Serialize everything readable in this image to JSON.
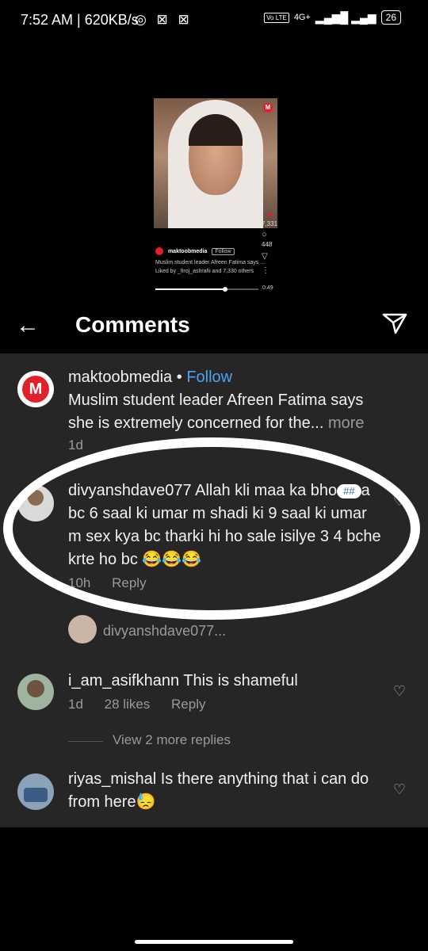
{
  "status_bar": {
    "time": "7:52 AM | 620KB/s",
    "volte": "Vo LTE",
    "network": "4G+",
    "battery": "26"
  },
  "video": {
    "account": "maktoobmedia",
    "follow": "Follow",
    "caption": "Muslim student leader Afreen Fatima says ...",
    "liked_by": "Liked by _firoj_ashrafii and 7,330 others",
    "likes": "7,331",
    "comments": "448",
    "elapsed": "0:49",
    "progress": 0.68
  },
  "header": {
    "title": "Comments"
  },
  "comments": [
    {
      "username": "maktoobmedia",
      "separator": "•",
      "follow": "Follow",
      "text": "Muslim student leader Afreen Fatima says she is extremely concerned for the...",
      "more": "more",
      "time": "1d"
    },
    {
      "username": "divyanshdave077",
      "text_a": "Allah kli maa ka bho",
      "censor": "##",
      "text_b": "a bc 6 saal ki umar m shadi ki 9 saal ki umar m sex kya bc tharki hi ho sale isilye 3 4 bche krte ho bc 😂😂😂",
      "time": "10h",
      "reply": "Reply"
    },
    {
      "username": "i_am_asifkhann",
      "text": "This is shameful",
      "time": "1d",
      "likes": "28 likes",
      "reply": "Reply"
    },
    {
      "username": "riyas_mishal",
      "text": "Is there anything that i can do from here😓"
    }
  ],
  "reply_preview": "divyanshdave077...",
  "view_more": "View 2 more replies"
}
